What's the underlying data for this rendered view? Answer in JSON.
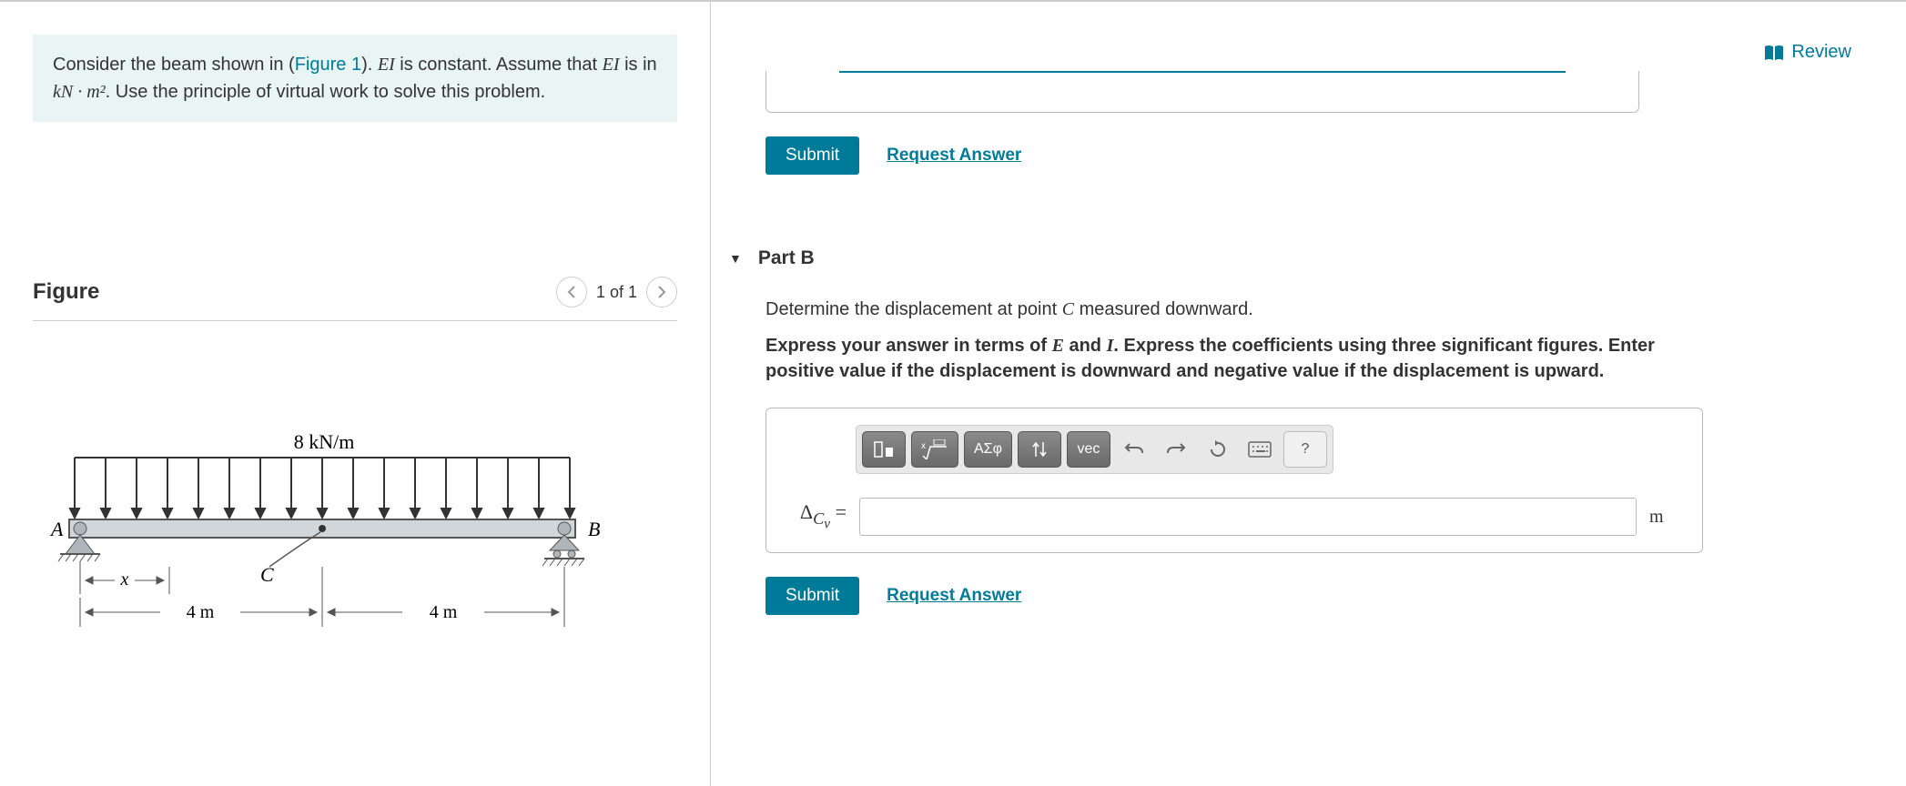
{
  "prompt": {
    "prefix": "Consider the beam shown in (",
    "figlink": "Figure 1",
    "after_link": "). ",
    "ei1": "EI",
    "mid1": " is constant. Assume that ",
    "ei2": "EI",
    "mid2": " is in ",
    "units": "kN · m²",
    "tail": ". Use the principle of virtual work to solve this problem."
  },
  "figure": {
    "title": "Figure",
    "counter": "1 of 1",
    "load_label": "8 kN/m",
    "A": "A",
    "B": "B",
    "C": "C",
    "x": "x",
    "dim1": "4 m",
    "dim2": "4 m"
  },
  "review": "Review",
  "submit": "Submit",
  "request_answer": "Request Answer",
  "partB": {
    "title": "Part B",
    "question_pre": "Determine the displacement at point ",
    "pointC": "C",
    "question_post": " measured downward.",
    "instr_pre": "Express your answer in terms of ",
    "E": "E",
    "and": " and ",
    "I": "I",
    "instr_post": ". Express the coefficients using three significant figures. Enter positive value if the displacement is downward and negative value if the displacement is upward.",
    "tb_greek": "ΑΣφ",
    "tb_vec": "vec",
    "tb_help": "?",
    "label_html": "Δ<sub><i>C</i><sub><i>v</i></sub></sub> =",
    "unit": "m"
  }
}
